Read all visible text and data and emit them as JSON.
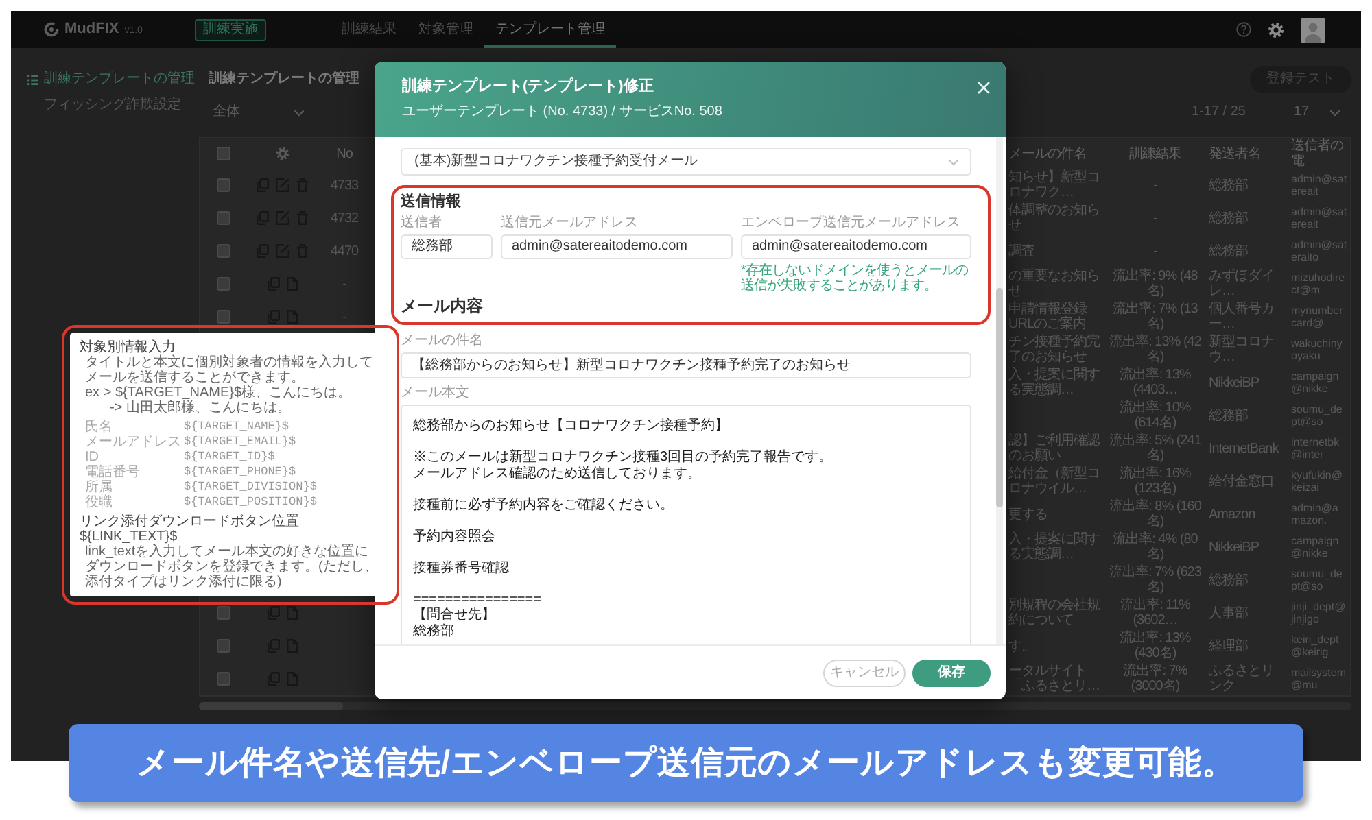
{
  "app_bar": {
    "logo": "MudFIX",
    "version": "v1.0",
    "action_button": "訓練実施",
    "tabs": [
      {
        "label": "訓練結果",
        "selected": false
      },
      {
        "label": "対象管理",
        "selected": false
      },
      {
        "label": "テンプレート管理",
        "selected": true
      }
    ]
  },
  "sidebar": {
    "items": [
      {
        "label": "訓練テンプレートの管理",
        "selected": true,
        "children": [
          {
            "label": "フィッシング詐欺設定",
            "selected": false
          }
        ]
      }
    ]
  },
  "page": {
    "title": "訓練テンプレートの管理",
    "register_button": "登録テスト",
    "filter": "全体",
    "range": "1-17 / 25",
    "page_size": "17"
  },
  "table": {
    "header_checked": false,
    "columns": [
      "No",
      "メールの件名",
      "訓練結果",
      "発送者名",
      "送信者の電"
    ],
    "rows": [
      {
        "kind": "user",
        "checked": false,
        "no": "4733",
        "subject": "知らせ】新型コロナワク…",
        "result": "-",
        "sender": "総務部",
        "email": "admin@satereait"
      },
      {
        "kind": "user",
        "checked": false,
        "no": "4732",
        "subject": "体調整のお知らせ",
        "result": "-",
        "sender": "総務部",
        "email": "admin@satereait"
      },
      {
        "kind": "user",
        "checked": false,
        "no": "4470",
        "subject": "調査",
        "result": "-",
        "sender": "総務部",
        "email": "admin@sateraito"
      },
      {
        "kind": "base",
        "checked": false,
        "no": "-",
        "subject": "の重要なお知らせ",
        "result": "流出率: 9% (48名)",
        "sender": "みずほダイレ…",
        "email": "mizuhodirect@m"
      },
      {
        "kind": "base",
        "checked": false,
        "no": "-",
        "subject": "申請情報登録URLのご案内",
        "result": "流出率: 7% (13名)",
        "sender": "個人番号カー…",
        "email": "mynumbercard@"
      },
      {
        "subject": "チン接種予約完了のお知らせ",
        "result": "流出率: 13% (42名)",
        "sender": "新型コロナウ…",
        "email": "wakuchinyoyaku"
      },
      {
        "subject": "入・提案に関する実態調…",
        "result": "流出率: 13% (4403…",
        "sender": "NikkeiBP",
        "email": "campaign@nikke"
      },
      {
        "result": "流出率: 10% (614名)",
        "sender": "総務部",
        "email": "soumu_dept@so"
      },
      {
        "subject": "認】ご利用確認のお願い",
        "result": "流出率: 5% (241名)",
        "sender": "InternetBank",
        "email": "internetbk@inter"
      },
      {
        "subject": "給付金（新型コロナウイル…",
        "result": "流出率: 16% (123名)",
        "sender": "給付金窓口",
        "email": "kyufukin@keizai"
      },
      {
        "subject": "更する",
        "result": "流出率: 8% (160名)",
        "sender": "Amazon",
        "email": "admin@amazon."
      },
      {
        "subject": "入・提案に関する実態調…",
        "result": "流出率: 4% (80名)",
        "sender": "NikkeiBP",
        "email": "campaign@nikke"
      },
      {
        "result": "流出率: 7% (623名)",
        "sender": "総務部",
        "email": "soumu_dept@so"
      },
      {
        "kind": "base",
        "checked": false,
        "subject": "別規程の会社規約について",
        "result": "流出率: 11% (3602…",
        "sender": "人事部",
        "email": "jinji_dept@jinjigo"
      },
      {
        "kind": "base",
        "checked": false,
        "subject": "す。",
        "result": "流出率: 13% (430名)",
        "sender": "経理部",
        "email": "keiri_dept@keirig"
      },
      {
        "kind": "base",
        "checked": false,
        "subject": "ータルサイト「ふるさとリ…",
        "result": "流出率: 7% (3000名)",
        "sender": "ふるさとリンク",
        "email": "mailsystem@mu"
      }
    ]
  },
  "dialog": {
    "title": "訓練テンプレート(テンプレート)修正",
    "subtitle": "ユーザーテンプレート (No. 4733) / サービスNo. 508",
    "template": "(基本)新型コロナワクチン接種予約受付メール",
    "sender_info": {
      "heading": "送信情報",
      "fields": [
        {
          "label": "送信者",
          "value": "総務部"
        },
        {
          "label": "送信元メールアドレス",
          "value": "admin@satereaitodemo.com"
        },
        {
          "label": "エンベロープ送信元メールアドレス",
          "value": "admin@satereaitodemo.com",
          "hint": "*存在しないドメインを使うとメールの送信が失敗することがあります。"
        }
      ]
    },
    "content_heading": "メール内容",
    "subject": {
      "label": "メールの件名",
      "value": "【総務部からのお知らせ】新型コロナワクチン接種予約完了のお知らせ"
    },
    "body": {
      "label": "メール本文",
      "paragraphs": [
        [
          "総務部からのお知らせ【コロナワクチン接種予約】"
        ],
        [
          "※このメールは新型コロナワクチン接種3回目の予約完了報告です。",
          "メールアドレス確認のため送信しております。"
        ],
        [
          "接種前に必ず予約内容をご確認ください。"
        ],
        [
          "予約内容照会"
        ],
        [
          "接種券番号確認"
        ],
        [
          "================",
          "【問合せ先】",
          "総務部"
        ]
      ]
    },
    "buttons": [
      {
        "label": "キャンセル",
        "kind": "secondary"
      },
      {
        "label": "保存",
        "kind": "primary"
      }
    ]
  },
  "help_popover": {
    "title": "対象別情報入力",
    "description": "タイトルと本文に個別対象者の情報を入力してメールを送信することができます。",
    "example": "ex > ${TARGET_NAME}$様、こんにちは。",
    "example_result": "-> 山田太郎様、こんにちは。",
    "variables": [
      {
        "label": "氏名",
        "value": "${TARGET_NAME}$"
      },
      {
        "label": "メールアドレス",
        "value": "${TARGET_EMAIL}$"
      },
      {
        "label": "ID",
        "value": "${TARGET_ID}$"
      },
      {
        "label": "電話番号",
        "value": "${TARGET_PHONE}$"
      },
      {
        "label": "所属",
        "value": "${TARGET_DIVISION}$"
      },
      {
        "label": "役職",
        "value": "${TARGET_POSITION}$"
      }
    ],
    "link_title": "リンク添付ダウンロードボタン位置",
    "link_code": "${LINK_TEXT}$",
    "link_description": "link_textを入力してメール本文の好きな位置にダウンロードボタンを登録できます。(ただし、添付タイプはリンク添付に限る)"
  },
  "caption": "メール件名や送信先/エンベロープ送信元のメールアドレスも変更可能。"
}
